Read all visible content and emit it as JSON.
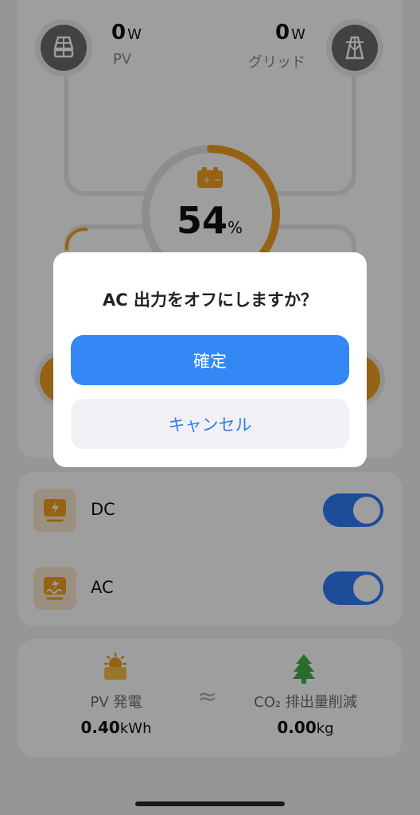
{
  "flow": {
    "pv": {
      "value": "0",
      "unit": "W",
      "label": "PV"
    },
    "grid": {
      "value": "0",
      "unit": "W",
      "label": "グリッド"
    },
    "battery": {
      "percent": "54",
      "unit": "%",
      "level": 0.54
    }
  },
  "outputs": [
    {
      "label": "DC",
      "icon": "dc-output-icon",
      "on": true
    },
    {
      "label": "AC",
      "icon": "ac-output-icon",
      "on": true
    }
  ],
  "stats": {
    "pv": {
      "label": "PV 発電",
      "value": "0.40",
      "unit": "kWh"
    },
    "approx": "≈",
    "co2": {
      "label": "CO₂ 排出量削減",
      "value": "0.00",
      "unit": "kg"
    }
  },
  "dialog": {
    "title": "AC 出力をオフにしますか？",
    "confirm": "確定",
    "cancel": "キャンセル"
  },
  "colors": {
    "accent": "#3388f5",
    "battery": "#f0a020",
    "switch": "#2f7bf6"
  }
}
